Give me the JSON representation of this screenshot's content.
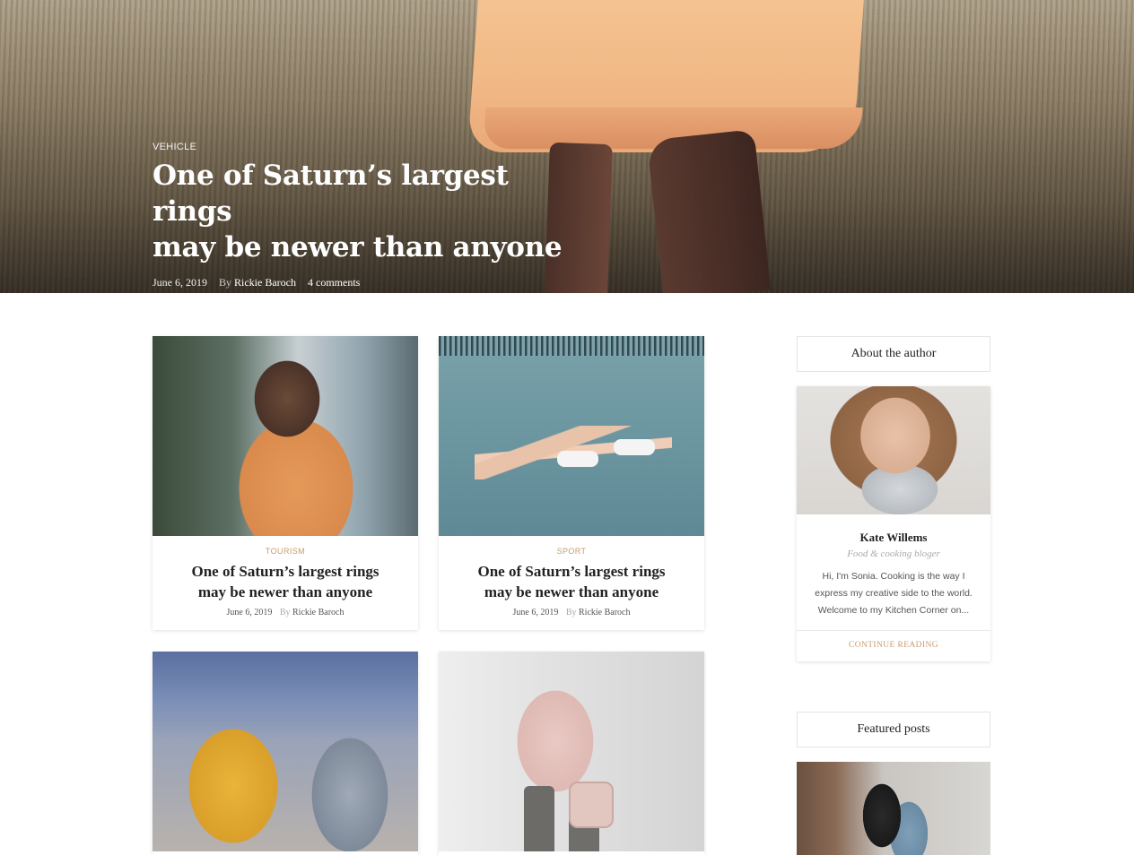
{
  "hero": {
    "category": "VEHICLE",
    "title_line1": "One of Saturn’s largest rings",
    "title_line2": "may be newer than anyone",
    "date": "June 6, 2019",
    "by": "By",
    "author": "Rickie Baroch",
    "comments": "4 comments"
  },
  "cards": [
    {
      "category": "TOURISM",
      "title_line1": "One of Saturn’s largest rings",
      "title_line2": "may be newer than anyone",
      "date": "June 6, 2019",
      "by": "By",
      "author": "Rickie Baroch"
    },
    {
      "category": "SPORT",
      "title_line1": "One of Saturn’s largest rings",
      "title_line2": "may be newer than anyone",
      "date": "June 6, 2019",
      "by": "By",
      "author": "Rickie Baroch"
    }
  ],
  "sidebar": {
    "about_title": "About the author",
    "author_name": "Kate Willems",
    "author_role": "Food & cooking bloger",
    "bio_line1": "Hi, I'm Sonia. Cooking is the way I",
    "bio_line2": "express my creative side to the world.",
    "bio_line3": "Welcome to my Kitchen Corner on...",
    "continue_label": "CONTINUE READING",
    "featured_title": "Featured posts"
  },
  "colors": {
    "accent": "#c99b6d",
    "text": "#222222",
    "muted": "#aaaaaa"
  }
}
